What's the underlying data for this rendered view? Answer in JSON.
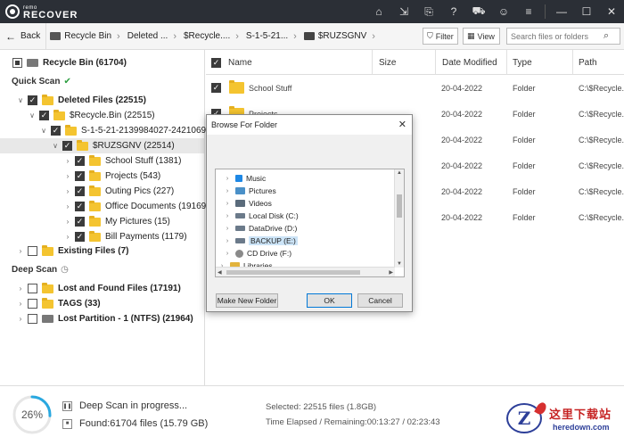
{
  "app": {
    "logo_small": "remo",
    "logo_big": "RECOVER"
  },
  "titlebar": {
    "icons": [
      "home-icon",
      "save-session-icon",
      "export-icon",
      "help-icon",
      "cart-icon",
      "account-icon",
      "menu-icon",
      "minimize-icon",
      "maximize-icon",
      "close-icon"
    ]
  },
  "nav": {
    "back_label": "Back",
    "breadcrumbs": [
      "Recycle Bin",
      "Deleted ...",
      "$Recycle....",
      "S-1-5-21...",
      "$RUZSGNV"
    ],
    "filter_label": "Filter",
    "view_label": "View",
    "search_placeholder": "Search files or folders"
  },
  "tree": {
    "root": {
      "label": "Recycle Bin (61704)",
      "checked": "partial"
    },
    "quick_scan_label": "Quick Scan",
    "items": [
      {
        "label": "Deleted Files (22515)",
        "bold": true
      },
      {
        "label": "$Recycle.Bin (22515)"
      },
      {
        "label": "S-1-5-21-2139984027-2421069"
      },
      {
        "label": "$RUZSGNV (22514)"
      },
      {
        "label": "School Stuff (1381)"
      },
      {
        "label": "Projects (543)"
      },
      {
        "label": "Outing Pics (227)"
      },
      {
        "label": "Office Documents (19169)"
      },
      {
        "label": "My Pictures (15)"
      },
      {
        "label": "Bill Payments (1179)"
      },
      {
        "label": "Existing Files (7)",
        "bold": true
      }
    ],
    "deep_scan_label": "Deep Scan",
    "deep_items": [
      {
        "label": "Lost and Found Files (17191)"
      },
      {
        "label": "TAGS (33)"
      },
      {
        "label": "Lost Partition - 1 (NTFS) (21964)"
      }
    ]
  },
  "filelist": {
    "columns": [
      "Name",
      "Size",
      "Date Modified",
      "Type",
      "Path"
    ],
    "rows": [
      {
        "name": "School Stuff",
        "date": "20-04-2022",
        "type": "Folder",
        "path": "C:\\$Recycle..."
      },
      {
        "name": "Projects",
        "date": "20-04-2022",
        "type": "Folder",
        "path": "C:\\$Recycle..."
      },
      {
        "name": "",
        "date": "20-04-2022",
        "type": "Folder",
        "path": "C:\\$Recycle..."
      },
      {
        "name": "",
        "date": "20-04-2022",
        "type": "Folder",
        "path": "C:\\$Recycle..."
      },
      {
        "name": "",
        "date": "20-04-2022",
        "type": "Folder",
        "path": "C:\\$Recycle..."
      },
      {
        "name": "",
        "date": "20-04-2022",
        "type": "Folder",
        "path": "C:\\$Recycle..."
      }
    ]
  },
  "dialog": {
    "title": "Browse For Folder",
    "items": [
      {
        "label": "Music",
        "icon": "music-icon",
        "color": "#1e88e5"
      },
      {
        "label": "Pictures",
        "icon": "pictures-icon",
        "color": "#4a90c8"
      },
      {
        "label": "Videos",
        "icon": "videos-icon",
        "color": "#5a6b7b"
      },
      {
        "label": "Local Disk (C:)",
        "icon": "drive-icon",
        "color": "#6b7a8a"
      },
      {
        "label": "DataDrive (D:)",
        "icon": "drive-icon",
        "color": "#6b7a8a"
      },
      {
        "label": "BACKUP (E:)",
        "icon": "drive-icon",
        "color": "#6b7a8a",
        "selected": true
      },
      {
        "label": "CD Drive (F:)",
        "icon": "cd-drive-icon",
        "color": "#8a8a8a"
      },
      {
        "label": "Libraries",
        "icon": "libraries-icon",
        "color": "#e2b33c"
      }
    ],
    "make_folder_label": "Make New Folder",
    "ok_label": "OK",
    "cancel_label": "Cancel"
  },
  "footer": {
    "progress_percent": 26,
    "progress_label": "26%",
    "status_line": "Deep Scan in progress...",
    "found_line": "Found:61704 files (15.79 GB)",
    "selected_line": "Selected: 22515 files (1.8GB)",
    "time_line": "Time Elapsed / Remaining:00:13:27 / 02:23:43"
  },
  "watermark": {
    "cn": "这里下载站",
    "en": "heredown.com"
  },
  "colors": {
    "titlebar_bg": "#2b2f36",
    "progress_accent": "#29a8e0",
    "folder": "#f4c430",
    "selection": "#cce4f7"
  }
}
